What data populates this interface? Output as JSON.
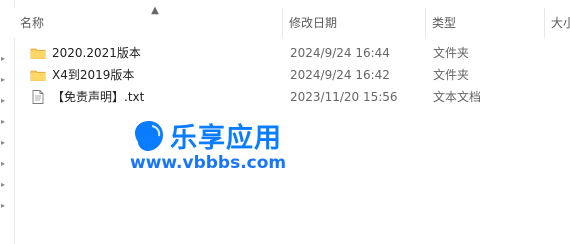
{
  "columns": {
    "name": "名称",
    "date_modified": "修改日期",
    "type": "类型",
    "size": "大小"
  },
  "sort": {
    "icon": "sort-up-arrow-icon"
  },
  "files": [
    {
      "icon": "folder-icon",
      "name": "2020.2021版本",
      "date_modified": "2024/9/24 16:44",
      "type": "文件夹"
    },
    {
      "icon": "folder-icon",
      "name": "X4到2019版本",
      "date_modified": "2024/9/24 16:42",
      "type": "文件夹"
    },
    {
      "icon": "text-file-icon",
      "name": "【免责声明】.txt",
      "date_modified": "2023/11/20 15:56",
      "type": "文本文档"
    }
  ],
  "watermark": {
    "brand": "乐享应用",
    "url": "www.vbbbs.com"
  },
  "colors": {
    "folder": "#f4c95d",
    "brand_blue": "#0a7cff"
  }
}
